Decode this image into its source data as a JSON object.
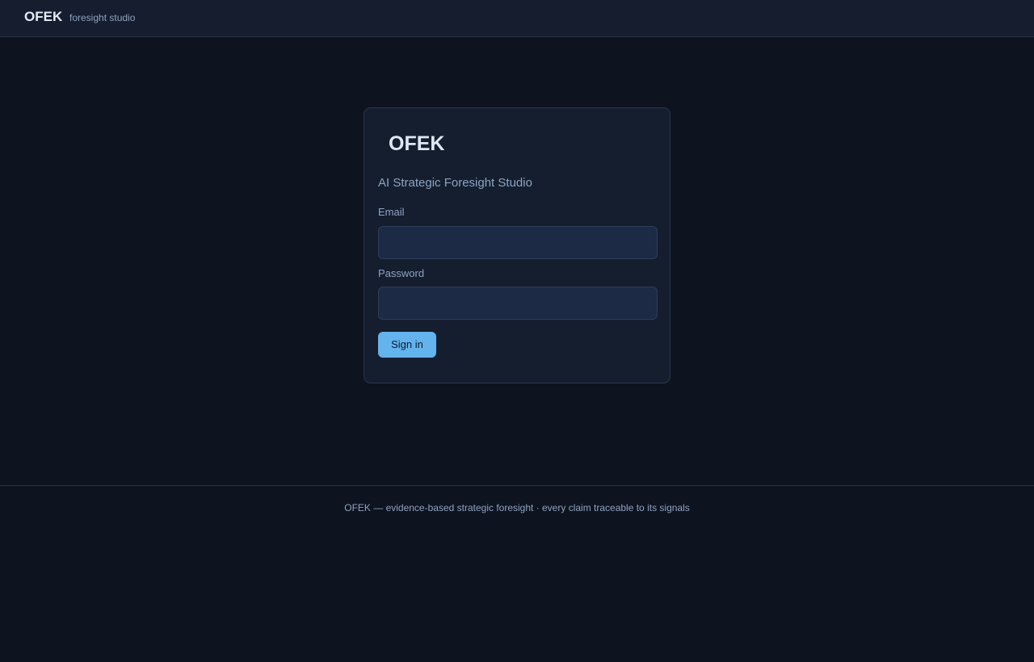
{
  "header": {
    "brand": "OFEK",
    "tagline": "foresight studio"
  },
  "login": {
    "title": "OFEK",
    "subtitle": "AI Strategic Foresight Studio",
    "email_label": "Email",
    "email_value": "",
    "password_label": "Password",
    "password_value": "",
    "submit_label": "Sign in"
  },
  "footer": {
    "text": "OFEK — evidence-based strategic foresight · every claim traceable to its signals"
  },
  "colors": {
    "background": "#0e1320",
    "accent": "#63b3ed"
  }
}
